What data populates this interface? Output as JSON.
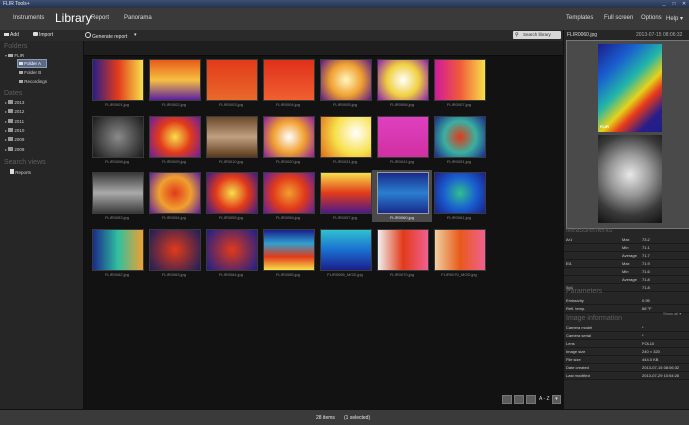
{
  "title_bar": {
    "title": "FLIR Tools+",
    "minimize": "_",
    "maximize": "□",
    "close": "✕"
  },
  "menu": {
    "logo": "FLIR",
    "left": [
      "Instruments",
      "Library",
      "Report",
      "Panorama"
    ],
    "right": [
      "Templates",
      "Full screen",
      "Options",
      "Help ▾"
    ]
  },
  "toolbar": {
    "add": "Add",
    "import": "Import",
    "generate_report": "Generate report",
    "dropdown": "▾",
    "search_placeholder": "Search library"
  },
  "sidebar": {
    "folders_heading": "Folders",
    "root": "FLIR",
    "folders": [
      "Folder A",
      "Folder B",
      "Recordings"
    ],
    "dates_heading": "Dates",
    "dates": [
      "2013",
      "2012",
      "2011",
      "2010",
      "2009",
      "2008"
    ],
    "search_views_heading": "Search views",
    "search_views": [
      "Reports"
    ]
  },
  "thumbnails": [
    [
      "FLIR0001.jpg",
      "FLIR0002.jpg",
      "FLIR0003.jpg",
      "FLIR0004.jpg",
      "FLIR0005.jpg",
      "FLIR0006.jpg",
      "FLIR0007.jpg"
    ],
    [
      "FLIR0008.jpg",
      "FLIR0009.jpg",
      "FLIR0010.jpg",
      "FLIR0020.jpg",
      "FLIR0031.jpg",
      "FLIR0041.jpg",
      "FLIR0051.jpg"
    ],
    [
      "FLIR0053.jpg",
      "FLIR0054.jpg",
      "FLIR0055.jpg",
      "FLIR0056.jpg",
      "FLIR0057.jpg",
      "FLIR0060.jpg",
      "FLIR0061.jpg"
    ],
    [
      "FLIR0062.jpg",
      "FLIR0063.jpg",
      "FLIR0064.jpg",
      "FLIR0065.jpg",
      "FLIR0065_MOD.jpg",
      "FLIR0070.jpg",
      "FLIR0070_MOD.jpg"
    ]
  ],
  "selected_thumbnail": "FLIR0060.jpg",
  "status": {
    "count": "28 items",
    "selected": "(1 selected)"
  },
  "view_controls": {
    "sort": "A - Z",
    "sort_dropdown": "▾"
  },
  "preview": {
    "filename": "FLIR0060.jpg",
    "timestamp": "2013-07-15 08:06:32",
    "logo": "FLIR"
  },
  "measurements": {
    "heading": "Measurements",
    "rows": [
      {
        "name": "Ar1",
        "stat": "Max",
        "value": "73.2"
      },
      {
        "name": "",
        "stat": "Min",
        "value": "71.1"
      },
      {
        "name": "",
        "stat": "Average",
        "value": "71.7"
      },
      {
        "name": "El1",
        "stat": "Max",
        "value": "71.9"
      },
      {
        "name": "",
        "stat": "Min",
        "value": "71.6"
      },
      {
        "name": "",
        "stat": "Average",
        "value": "71.8"
      },
      {
        "name": "Sp1",
        "stat": "",
        "value": "71.8"
      }
    ]
  },
  "parameters": {
    "heading": "Parameters",
    "rows": [
      {
        "label": "Emissivity",
        "value": "0.95"
      },
      {
        "label": "Refl. temp.",
        "value": "68 °F"
      }
    ],
    "show_all": "Show all ▾"
  },
  "image_info": {
    "heading": "Image information",
    "rows": [
      {
        "label": "Camera model",
        "value": "*"
      },
      {
        "label": "Camera serial",
        "value": "*"
      },
      {
        "label": "Lens",
        "value": "FOL10"
      },
      {
        "label": "Image size",
        "value": "240 × 320"
      },
      {
        "label": "File size",
        "value": "444.0 KB"
      },
      {
        "label": "Date created",
        "value": "2013-07-15 08:06:32"
      },
      {
        "label": "Last modified",
        "value": "2013-07-29 10:54:26"
      }
    ]
  },
  "colors": {
    "accent": "#3c4f73",
    "bg": "#1a1a1a",
    "panel": "#262626"
  }
}
